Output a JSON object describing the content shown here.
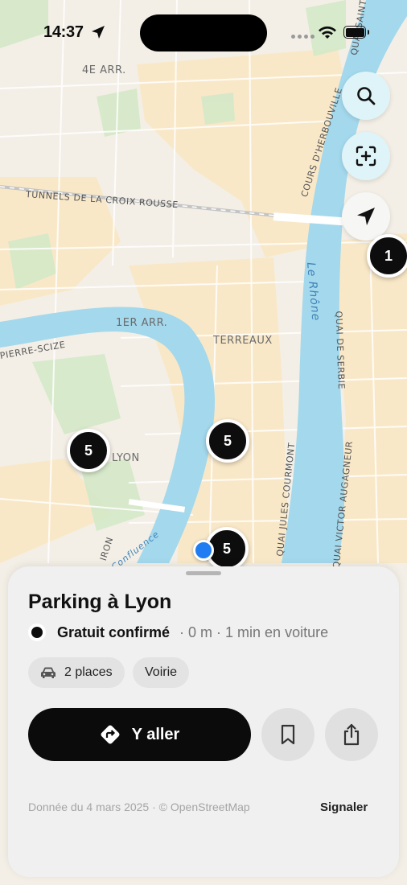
{
  "status_bar": {
    "time": "14:37",
    "icons": [
      "location-arrow-icon",
      "signal-icon",
      "wifi-icon",
      "battery-icon"
    ]
  },
  "map": {
    "district_labels": [
      "4E ARR.",
      "1ER ARR.",
      "TERREAUX"
    ],
    "partial_labels": [
      "X LYON"
    ],
    "street_labels": [
      "TUNNELS DE LA CROIX ROUSSE",
      "PIERRE-SCIZE",
      "COURS D'HERBOUVILLE",
      "QUAI DE SERBIE",
      "QUAI JULES COURMONT",
      "QUAI VICTOR AUGAGNEUR",
      "QUAI SAINT-ARISTIDE",
      "IRON"
    ],
    "river_labels": [
      "Le Rhône",
      "Confluence"
    ],
    "clusters": [
      "1",
      "5",
      "5",
      "5"
    ],
    "buttons": {
      "search_icon": "search-icon",
      "scan_icon": "scan-plus-icon",
      "locate_icon": "navigation-arrow-icon"
    },
    "colors": {
      "water": "#a4d8ec",
      "land": "#f3efe6",
      "urban": "#fbe6bd",
      "park": "#d4e9c8"
    }
  },
  "sheet": {
    "title": "Parking à Lyon",
    "status": "Gratuit confirmé",
    "meta": "· 0 m · 1 min en voiture",
    "chips": [
      {
        "icon": "car-icon",
        "label": "2 places"
      },
      {
        "label": "Voirie"
      }
    ],
    "go_label": "Y aller",
    "go_icon": "directions-icon",
    "bookmark_icon": "bookmark-icon",
    "share_icon": "share-icon",
    "source": "Donnée du 4 mars 2025 · © OpenStreetMap",
    "report": "Signaler"
  }
}
